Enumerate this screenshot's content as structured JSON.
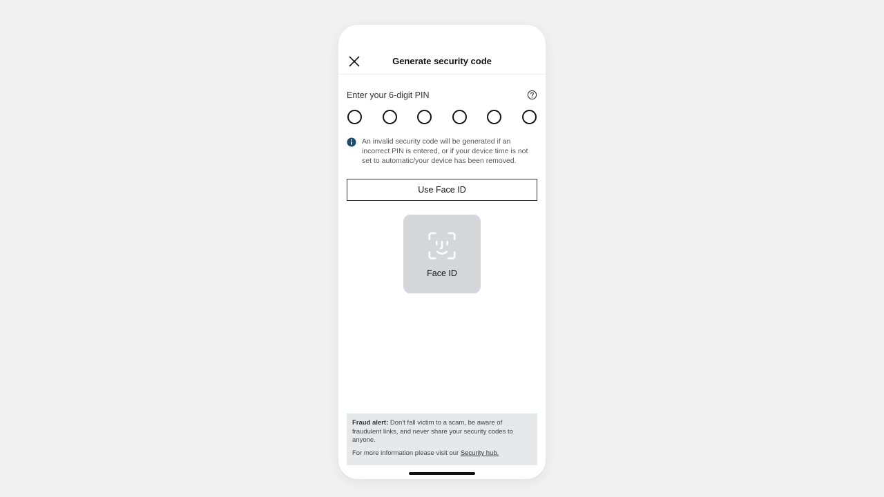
{
  "header": {
    "title": "Generate security code"
  },
  "pin": {
    "label": "Enter your 6-digit PIN",
    "count": 6
  },
  "info": {
    "text": "An invalid security code will be generated if an incorrect PIN is entered, or if your device time is not set to automatic/your device has been removed."
  },
  "face_id_button": {
    "label": "Use Face ID"
  },
  "face_id_tile": {
    "label": "Face ID"
  },
  "alert": {
    "strong": "Fraud alert:",
    "body": " Don't fall victim to a scam, be aware of fraudulent links, and never share your security codes to anyone.",
    "more_prefix": "For more information please visit our ",
    "link": "Security hub."
  }
}
